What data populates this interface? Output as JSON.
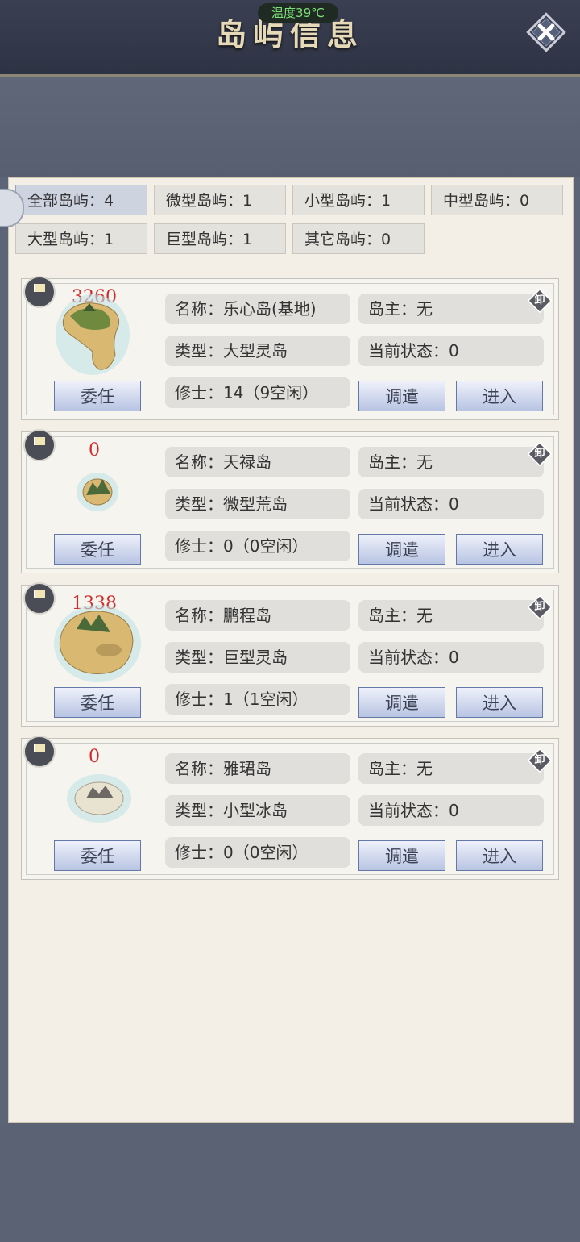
{
  "header": {
    "title": "岛屿信息",
    "temperature": "温度39℃"
  },
  "filters": [
    {
      "label": "全部岛屿：4",
      "active": true
    },
    {
      "label": "微型岛屿：1"
    },
    {
      "label": "小型岛屿：1"
    },
    {
      "label": "中型岛屿：0"
    },
    {
      "label": "大型岛屿：1"
    },
    {
      "label": "巨型岛屿：1"
    },
    {
      "label": "其它岛屿：0"
    }
  ],
  "islands": [
    {
      "count": "3260",
      "name": "名称：乐心岛(基地)",
      "owner": "岛主：无",
      "type": "类型：大型灵岛",
      "status": "当前状态：0",
      "cultivators": "修士：14（9空闲）",
      "assign": "委任",
      "dispatch": "调遣",
      "enter": "进入",
      "unload": "卸",
      "icon": "island-large"
    },
    {
      "count": "0",
      "name": "名称：天禄岛",
      "owner": "岛主：无",
      "type": "类型：微型荒岛",
      "status": "当前状态：0",
      "cultivators": "修士：0（0空闲）",
      "assign": "委任",
      "dispatch": "调遣",
      "enter": "进入",
      "unload": "卸",
      "icon": "island-micro"
    },
    {
      "count": "1338",
      "name": "名称：鹏程岛",
      "owner": "岛主：无",
      "type": "类型：巨型灵岛",
      "status": "当前状态：0",
      "cultivators": "修士：1（1空闲）",
      "assign": "委任",
      "dispatch": "调遣",
      "enter": "进入",
      "unload": "卸",
      "icon": "island-huge"
    },
    {
      "count": "0",
      "name": "名称：雅珺岛",
      "owner": "岛主：无",
      "type": "类型：小型冰岛",
      "status": "当前状态：0",
      "cultivators": "修士：0（0空闲）",
      "assign": "委任",
      "dispatch": "调遣",
      "enter": "进入",
      "unload": "卸",
      "icon": "island-ice"
    }
  ]
}
